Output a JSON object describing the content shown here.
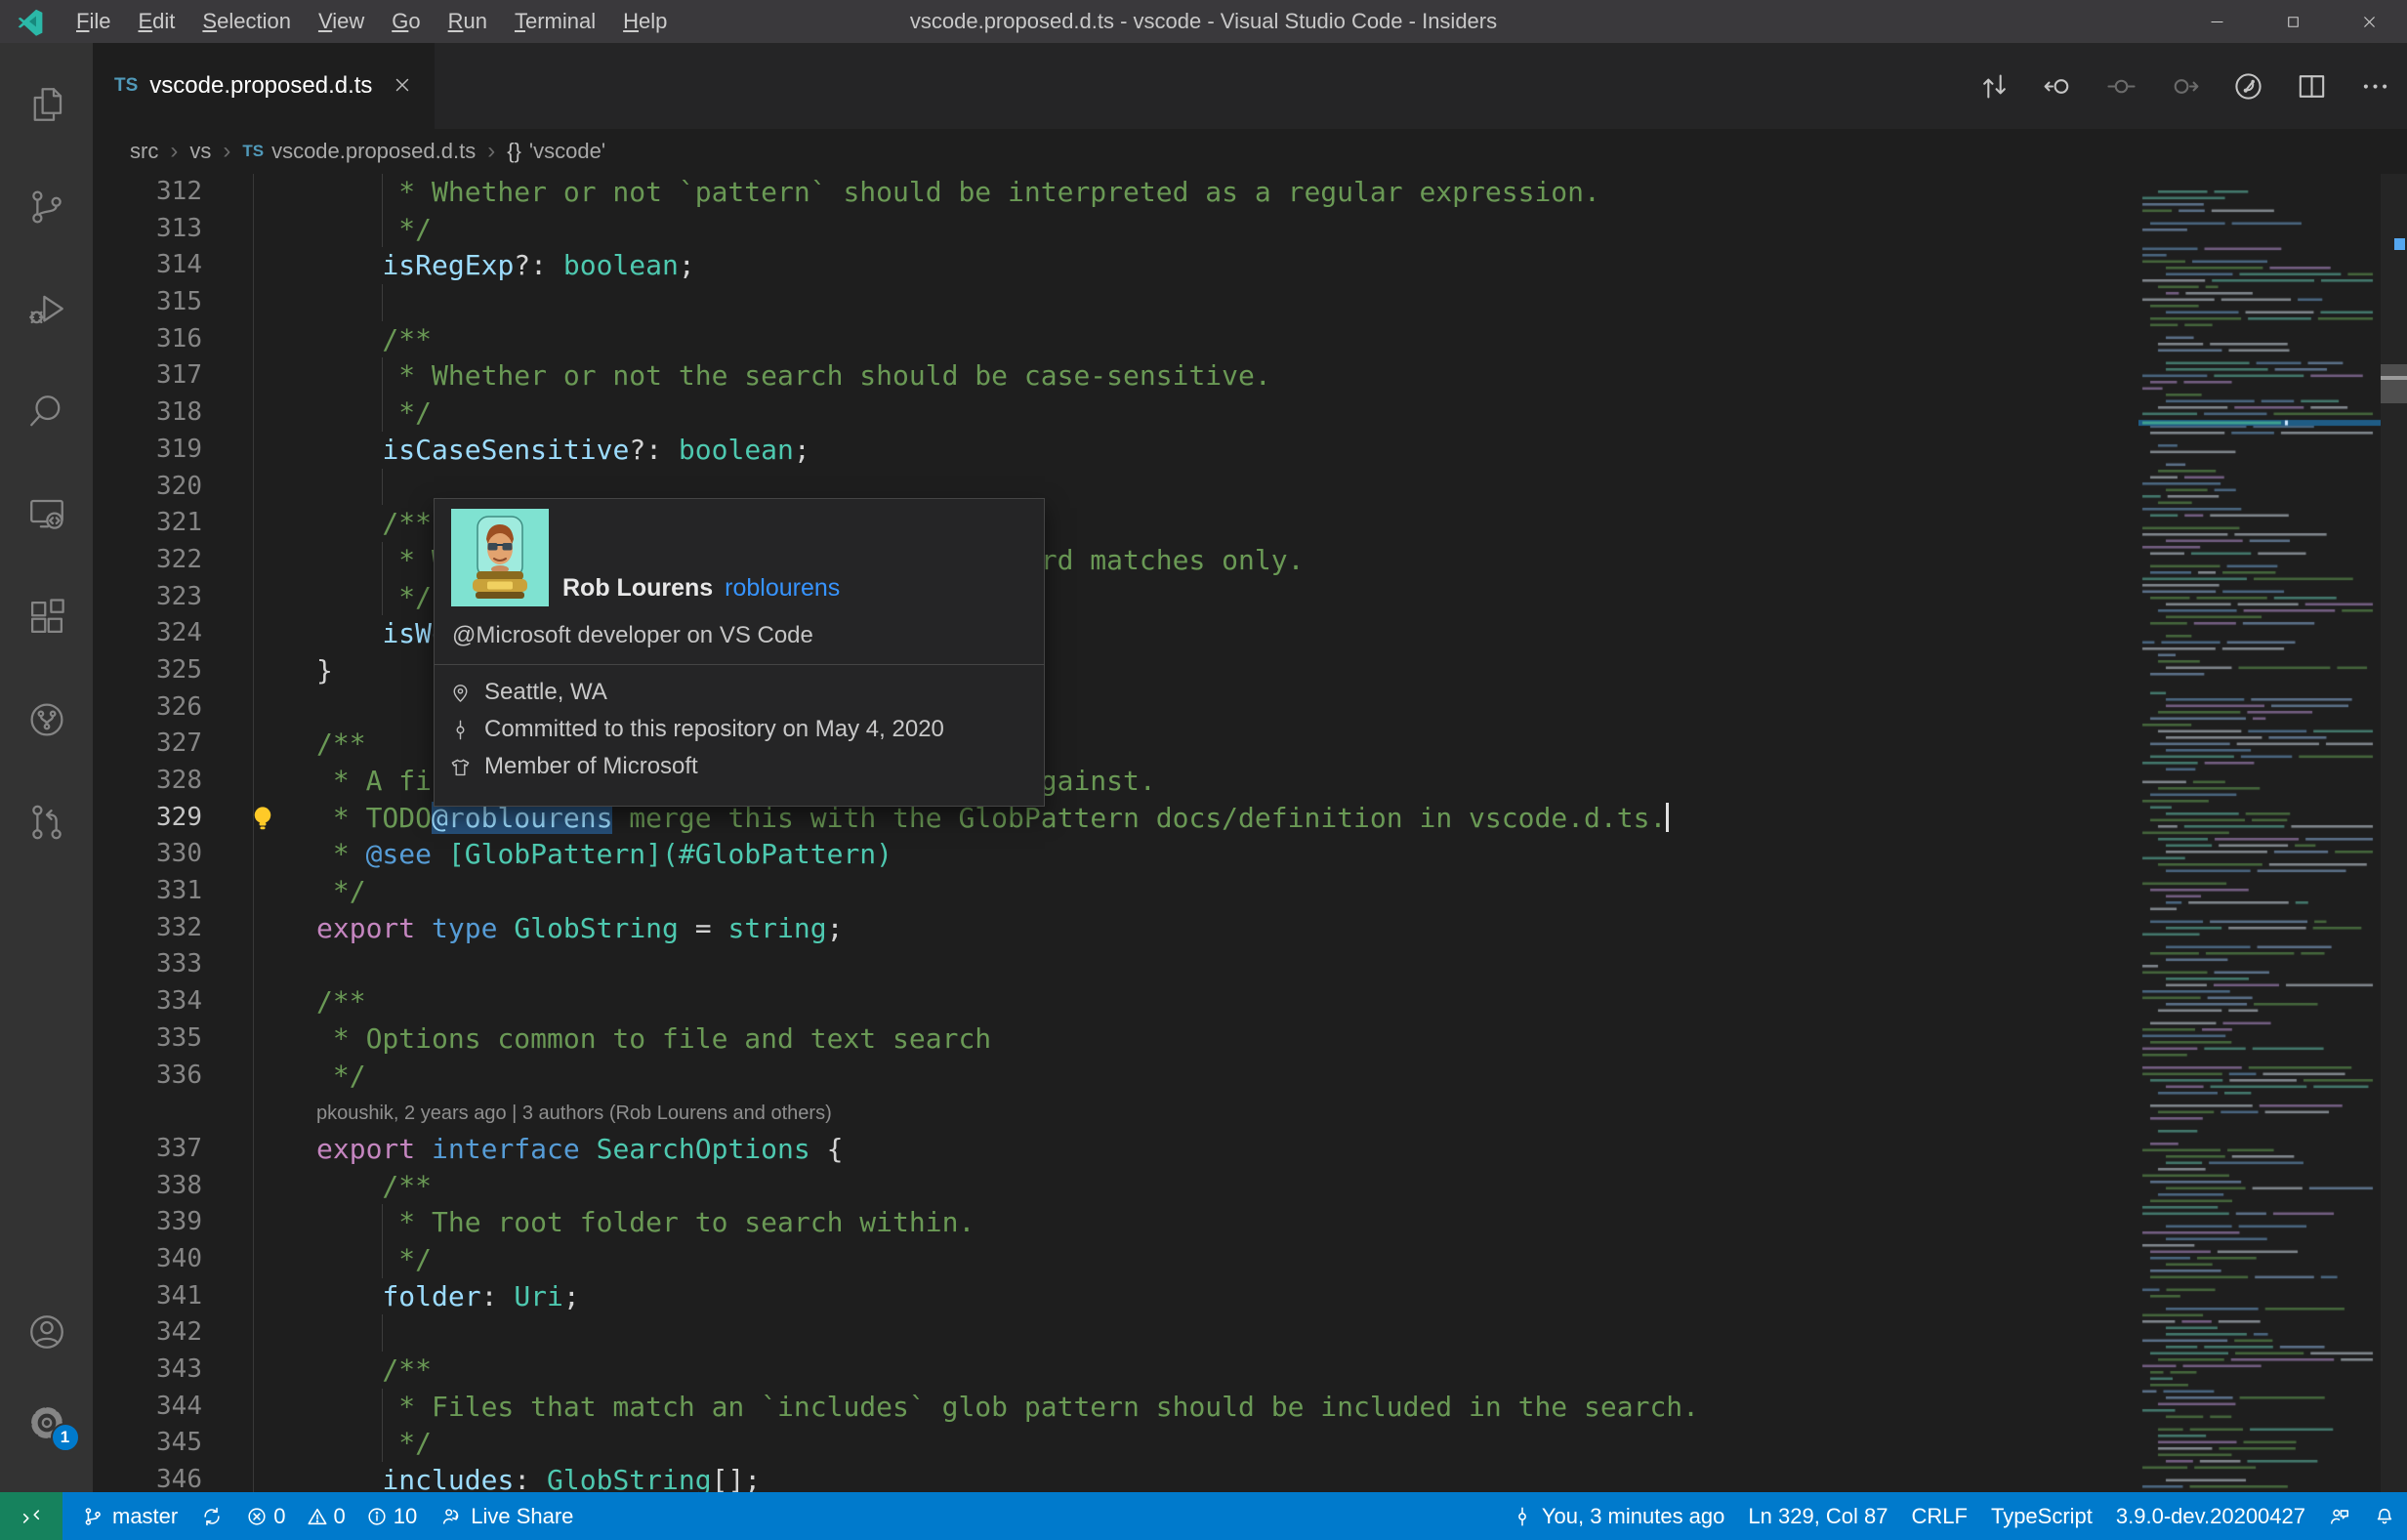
{
  "window": {
    "title": "vscode.proposed.d.ts - vscode - Visual Studio Code - Insiders",
    "menus": [
      "File",
      "Edit",
      "Selection",
      "View",
      "Go",
      "Run",
      "Terminal",
      "Help"
    ]
  },
  "activity_bar": {
    "items": [
      {
        "name": "explorer",
        "icon": "files"
      },
      {
        "name": "source-control",
        "icon": "source-control"
      },
      {
        "name": "run-and-debug",
        "icon": "run-debug"
      },
      {
        "name": "search",
        "icon": "search"
      },
      {
        "name": "remote-explorer",
        "icon": "remote-explorer"
      },
      {
        "name": "extensions",
        "icon": "extensions"
      },
      {
        "name": "github",
        "icon": "github-circle"
      },
      {
        "name": "pull-requests",
        "icon": "pull-request"
      }
    ],
    "bottom": [
      {
        "name": "accounts",
        "icon": "account"
      },
      {
        "name": "settings",
        "icon": "gear",
        "badge": "1"
      }
    ]
  },
  "tab": {
    "icon_text": "TS",
    "label": "vscode.proposed.d.ts"
  },
  "breadcrumbs": [
    {
      "label": "src"
    },
    {
      "label": "vs"
    },
    {
      "label": "vscode.proposed.d.ts",
      "icon_text": "TS"
    },
    {
      "label": "'vscode'",
      "symbol": "{}"
    }
  ],
  "editor_actions": [
    {
      "name": "open-changes",
      "icon": "compare",
      "dim": false
    },
    {
      "name": "previous-change",
      "icon": "prev-change",
      "dim": false
    },
    {
      "name": "open-revision",
      "icon": "gutter-dot",
      "dim": true
    },
    {
      "name": "next-change",
      "icon": "next-change",
      "dim": true
    },
    {
      "name": "file-history",
      "icon": "history",
      "dim": false
    },
    {
      "name": "split-editor",
      "icon": "split-editor",
      "dim": false
    },
    {
      "name": "more-actions",
      "icon": "ellipsis",
      "dim": false
    }
  ],
  "editor": {
    "blame_text": "pkoushik, 2 years ago | 3 authors (Rob Lourens and others)",
    "lines": [
      {
        "num": "312",
        "guide": true,
        "tokens": [
          [
            "cmt",
            "     * Whether or not `pattern` should be interpreted as a regular expression."
          ]
        ]
      },
      {
        "num": "313",
        "guide": true,
        "tokens": [
          [
            "cmt",
            "     */"
          ]
        ]
      },
      {
        "num": "314",
        "tokens": [
          [
            "pln",
            "    "
          ],
          [
            "prop",
            "isRegExp"
          ],
          [
            "pun",
            "?: "
          ],
          [
            "typ",
            "boolean"
          ],
          [
            "pun",
            ";"
          ]
        ]
      },
      {
        "num": "315",
        "guide": true,
        "tokens": []
      },
      {
        "num": "316",
        "tokens": [
          [
            "cmt",
            "    /**"
          ]
        ]
      },
      {
        "num": "317",
        "guide": true,
        "tokens": [
          [
            "cmt",
            "     * Whether or not the search should be case-sensitive."
          ]
        ]
      },
      {
        "num": "318",
        "guide": true,
        "tokens": [
          [
            "cmt",
            "     */"
          ]
        ]
      },
      {
        "num": "319",
        "tokens": [
          [
            "pln",
            "    "
          ],
          [
            "prop",
            "isCaseSensitive"
          ],
          [
            "pun",
            "?: "
          ],
          [
            "typ",
            "boolean"
          ],
          [
            "pun",
            ";"
          ]
        ]
      },
      {
        "num": "320",
        "guide": true,
        "tokens": []
      },
      {
        "num": "321",
        "tokens": [
          [
            "cmt",
            "    /**"
          ]
        ]
      },
      {
        "num": "322",
        "guide": true,
        "tokens": [
          [
            "cmt",
            "     * Whether or not to search for whole word matches only."
          ]
        ]
      },
      {
        "num": "323",
        "guide": true,
        "tokens": [
          [
            "cmt",
            "     */"
          ]
        ]
      },
      {
        "num": "324",
        "tokens": [
          [
            "pln",
            "    "
          ],
          [
            "prop",
            "isWordMatch"
          ],
          [
            "pun",
            "?: "
          ],
          [
            "typ",
            "boolean"
          ],
          [
            "pun",
            ";"
          ]
        ]
      },
      {
        "num": "325",
        "tokens": [
          [
            "pun",
            "}"
          ]
        ]
      },
      {
        "num": "326",
        "tokens": []
      },
      {
        "num": "327",
        "tokens": [
          [
            "cmt",
            "/**"
          ]
        ]
      },
      {
        "num": "328",
        "tokens": [
          [
            "cmt",
            " * A file glob pattern to match file paths against."
          ]
        ]
      },
      {
        "num": "329",
        "active": true,
        "lightbulb": true,
        "cursor": true,
        "tokens": [
          [
            "cmt",
            " * TODO"
          ],
          [
            "mention",
            "@roblourens"
          ],
          [
            "cmt",
            " merge this with the GlobPattern docs/definition in vscode.d.ts."
          ]
        ]
      },
      {
        "num": "330",
        "tokens": [
          [
            "cmt",
            " * "
          ],
          [
            "kw2",
            "@see"
          ],
          [
            "typ",
            " [GlobPattern](#GlobPattern)"
          ]
        ]
      },
      {
        "num": "331",
        "tokens": [
          [
            "cmt",
            " */"
          ]
        ]
      },
      {
        "num": "332",
        "tokens": [
          [
            "kw",
            "export"
          ],
          [
            "pln",
            " "
          ],
          [
            "kw2",
            "type"
          ],
          [
            "pln",
            " "
          ],
          [
            "typ",
            "GlobString"
          ],
          [
            "pun",
            " = "
          ],
          [
            "typ",
            "string"
          ],
          [
            "pun",
            ";"
          ]
        ]
      },
      {
        "num": "333",
        "tokens": []
      },
      {
        "num": "334",
        "tokens": [
          [
            "cmt",
            "/**"
          ]
        ]
      },
      {
        "num": "335",
        "tokens": [
          [
            "cmt",
            " * Options common to file and text search"
          ]
        ]
      },
      {
        "num": "336",
        "tokens": [
          [
            "cmt",
            " */"
          ]
        ]
      },
      {
        "num": "337",
        "blame_before": true,
        "tokens": [
          [
            "kw",
            "export"
          ],
          [
            "pln",
            " "
          ],
          [
            "kw2",
            "interface"
          ],
          [
            "pln",
            " "
          ],
          [
            "typ",
            "SearchOptions"
          ],
          [
            "pun",
            " {"
          ]
        ]
      },
      {
        "num": "338",
        "tokens": [
          [
            "cmt",
            "    /**"
          ]
        ]
      },
      {
        "num": "339",
        "guide": true,
        "tokens": [
          [
            "cmt",
            "     * The root folder to search within."
          ]
        ]
      },
      {
        "num": "340",
        "guide": true,
        "tokens": [
          [
            "cmt",
            "     */"
          ]
        ]
      },
      {
        "num": "341",
        "tokens": [
          [
            "pln",
            "    "
          ],
          [
            "prop",
            "folder"
          ],
          [
            "pun",
            ": "
          ],
          [
            "typ",
            "Uri"
          ],
          [
            "pun",
            ";"
          ]
        ]
      },
      {
        "num": "342",
        "guide": true,
        "tokens": []
      },
      {
        "num": "343",
        "tokens": [
          [
            "cmt",
            "    /**"
          ]
        ]
      },
      {
        "num": "344",
        "guide": true,
        "tokens": [
          [
            "cmt",
            "     * Files that match an `includes` glob pattern should be included in the search."
          ]
        ]
      },
      {
        "num": "345",
        "guide": true,
        "tokens": [
          [
            "cmt",
            "     */"
          ]
        ]
      },
      {
        "num": "346",
        "tokens": [
          [
            "pln",
            "    "
          ],
          [
            "prop",
            "includes"
          ],
          [
            "pun",
            ": "
          ],
          [
            "typ",
            "GlobString"
          ],
          [
            "pun",
            "[];"
          ]
        ]
      }
    ]
  },
  "hover_card": {
    "name": "Rob Lourens",
    "username": "roblourens",
    "bio": "@Microsoft developer on VS Code",
    "details": [
      {
        "icon": "location",
        "text": "Seattle, WA"
      },
      {
        "icon": "commit",
        "text": "Committed to this repository on May 4, 2020"
      },
      {
        "icon": "organization",
        "text": "Member of Microsoft"
      }
    ]
  },
  "status_bar": {
    "left": [
      {
        "name": "remote-indicator",
        "icon": "remote",
        "text": "",
        "style": "remote"
      },
      {
        "name": "git-branch",
        "icon": "branch",
        "text": "master"
      },
      {
        "name": "sync-changes",
        "icon": "sync",
        "text": ""
      },
      {
        "name": "problems",
        "parts": [
          {
            "icon": "error",
            "text": "0"
          },
          {
            "icon": "warning",
            "text": "0"
          },
          {
            "icon": "info",
            "text": "10"
          }
        ]
      },
      {
        "name": "live-share",
        "icon": "live-share",
        "text": "Live Share"
      }
    ],
    "right": [
      {
        "name": "blame-annotation",
        "icon": "commit",
        "text": "You, 3 minutes ago"
      },
      {
        "name": "cursor-position",
        "text": "Ln 329, Col 87"
      },
      {
        "name": "eol-sequence",
        "text": "CRLF"
      },
      {
        "name": "language-mode",
        "text": "TypeScript"
      },
      {
        "name": "typescript-version",
        "text": "3.9.0-dev.20200427"
      },
      {
        "name": "feedback",
        "icon": "feedback",
        "text": ""
      },
      {
        "name": "notifications",
        "icon": "bell",
        "text": ""
      }
    ]
  },
  "colors": {
    "accent": "#007ACC",
    "remote_bg": "#16825D",
    "badge": "#007ACC",
    "link": "#3794FF",
    "ts_icon": "#519ABA",
    "lightbulb": "#FFCA28",
    "minimap_highlight": "#1f5c85"
  },
  "minimap": {
    "seed": 7,
    "palette": [
      "#4f7a44",
      "#4f7a44",
      "#6b87a5",
      "#4e9181",
      "#8a6f9e",
      "#9aa3ab",
      "#567a9a"
    ]
  }
}
